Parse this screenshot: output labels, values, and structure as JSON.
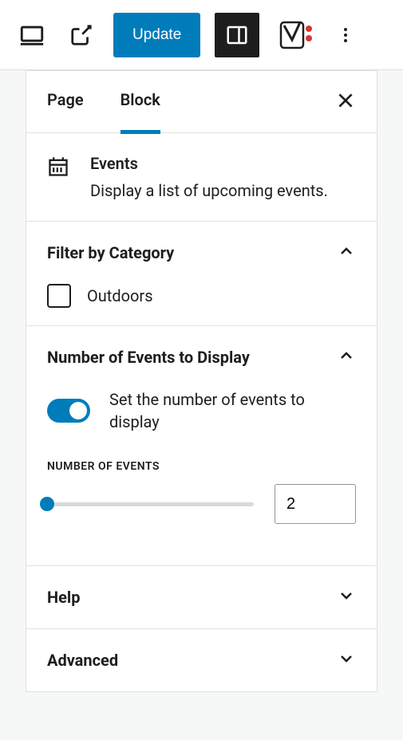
{
  "toolbar": {
    "update_label": "Update"
  },
  "tabs": {
    "page_label": "Page",
    "block_label": "Block"
  },
  "block": {
    "title": "Events",
    "description": "Display a list of upcoming events."
  },
  "filter_category": {
    "title": "Filter by Category",
    "options": [
      {
        "label": "Outdoors",
        "checked": false
      }
    ]
  },
  "number_events": {
    "title": "Number of Events to Display",
    "toggle_label": "Set the number of events to display",
    "toggle_on": true,
    "field_label": "Number of Events",
    "value": "2"
  },
  "help": {
    "title": "Help"
  },
  "advanced": {
    "title": "Advanced"
  }
}
